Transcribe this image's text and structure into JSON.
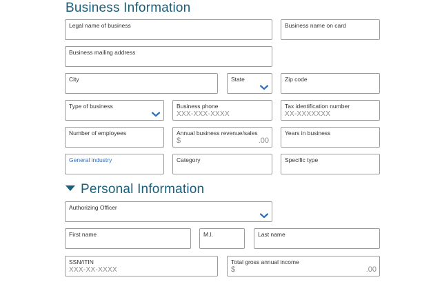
{
  "business_section": {
    "title": "Business Information",
    "fields": {
      "legal_name": {
        "label": "Legal name of business"
      },
      "name_on_card": {
        "label": "Business name on card"
      },
      "mailing_address": {
        "label": "Business mailing address"
      },
      "city": {
        "label": "City"
      },
      "state": {
        "label": "State"
      },
      "zip": {
        "label": "Zip code"
      },
      "type": {
        "label": "Type of business"
      },
      "phone": {
        "label": "Business phone",
        "placeholder": "XXX-XXX-XXXX"
      },
      "tax_id": {
        "label": "Tax identification number",
        "placeholder": "XX-XXXXXXX"
      },
      "employees": {
        "label": "Number of employees"
      },
      "revenue": {
        "label": "Annual business revenue/sales",
        "currency": "$",
        "cents": ".00"
      },
      "years": {
        "label": "Years in business"
      },
      "industry": {
        "label": "General industry"
      },
      "category": {
        "label": "Category"
      },
      "specific_type": {
        "label": "Specific type"
      }
    }
  },
  "personal_section": {
    "title": "Personal Information",
    "fields": {
      "officer": {
        "label": "Authorizing Officer"
      },
      "first_name": {
        "label": "First name"
      },
      "mi": {
        "label": "M.I."
      },
      "last_name": {
        "label": "Last name"
      },
      "ssn": {
        "label": "SSN/ITIN",
        "placeholder": "XXX-XX-XXXX"
      },
      "income": {
        "label": "Total gross annual income",
        "currency": "$",
        "cents": ".00"
      }
    }
  },
  "colors": {
    "heading": "#1a5f7a",
    "accent": "#2a6dc0",
    "border": "#9b9b9b"
  }
}
